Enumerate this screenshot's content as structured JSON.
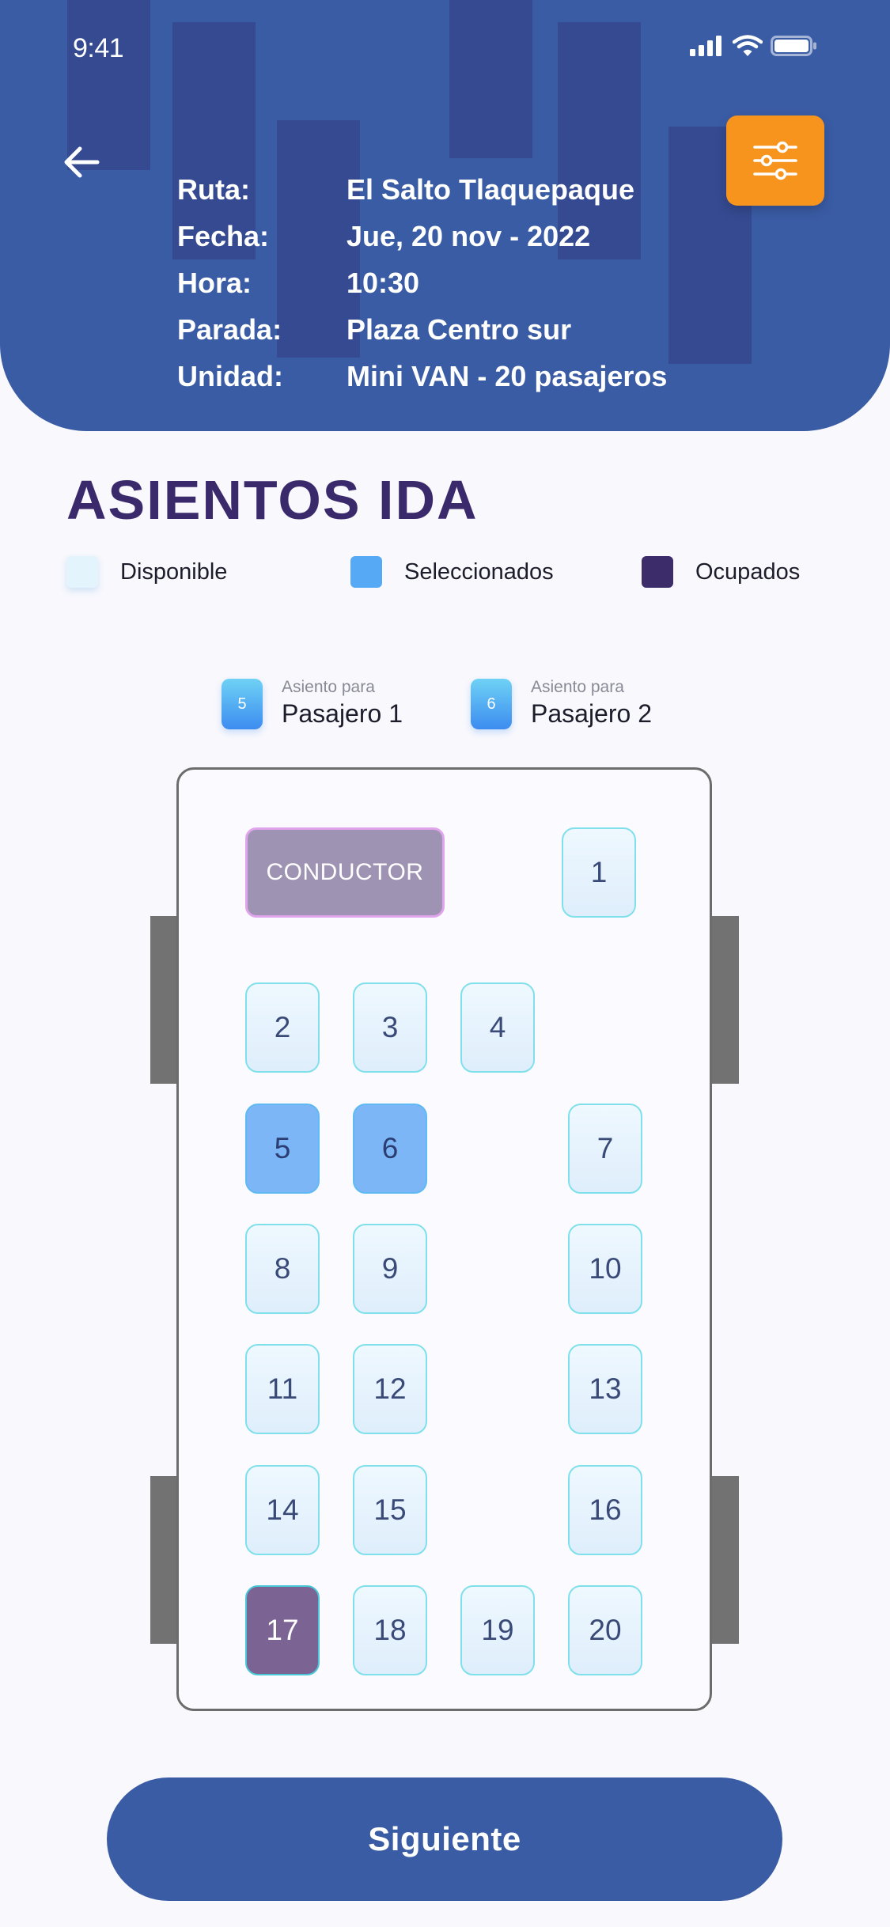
{
  "status_bar": {
    "time": "9:41"
  },
  "header": {
    "rows": [
      {
        "label": "Ruta:",
        "value": "El Salto Tlaquepaque"
      },
      {
        "label": "Fecha:",
        "value": "Jue, 20 nov - 2022"
      },
      {
        "label": "Hora:",
        "value": "10:30"
      },
      {
        "label": "Parada:",
        "value": "Plaza Centro sur"
      },
      {
        "label": "Unidad:",
        "value": "Mini VAN - 20 pasajeros"
      }
    ],
    "back_icon": "arrow-left-icon",
    "filter_icon": "sliders-icon",
    "colors": {
      "header_bg": "#3a5ca5",
      "filter_bg": "#f7941d"
    }
  },
  "section_title": "ASIENTOS IDA",
  "legend": {
    "available": {
      "label": "Disponible",
      "color": "#e4f4fc"
    },
    "selected": {
      "label": "Seleccionados",
      "color": "#55a9f5"
    },
    "occupied": {
      "label": "Ocupados",
      "color": "#3d2c6a"
    }
  },
  "passengers": [
    {
      "seat": "5",
      "caption": "Asiento para",
      "name": "Pasajero 1"
    },
    {
      "seat": "6",
      "caption": "Asiento para",
      "name": "Pasajero 2"
    }
  ],
  "van": {
    "driver_label": "CONDUCTOR",
    "seats": [
      {
        "number": "1",
        "state": "available"
      },
      {
        "number": "2",
        "state": "available"
      },
      {
        "number": "3",
        "state": "available"
      },
      {
        "number": "4",
        "state": "available"
      },
      {
        "number": "5",
        "state": "selected"
      },
      {
        "number": "6",
        "state": "selected"
      },
      {
        "number": "7",
        "state": "available"
      },
      {
        "number": "8",
        "state": "available"
      },
      {
        "number": "9",
        "state": "available"
      },
      {
        "number": "10",
        "state": "available"
      },
      {
        "number": "11",
        "state": "available"
      },
      {
        "number": "12",
        "state": "available"
      },
      {
        "number": "13",
        "state": "available"
      },
      {
        "number": "14",
        "state": "available"
      },
      {
        "number": "15",
        "state": "available"
      },
      {
        "number": "16",
        "state": "available"
      },
      {
        "number": "17",
        "state": "occupied"
      },
      {
        "number": "18",
        "state": "available"
      },
      {
        "number": "19",
        "state": "available"
      },
      {
        "number": "20",
        "state": "available"
      }
    ]
  },
  "next_button": {
    "label": "Siguiente"
  }
}
